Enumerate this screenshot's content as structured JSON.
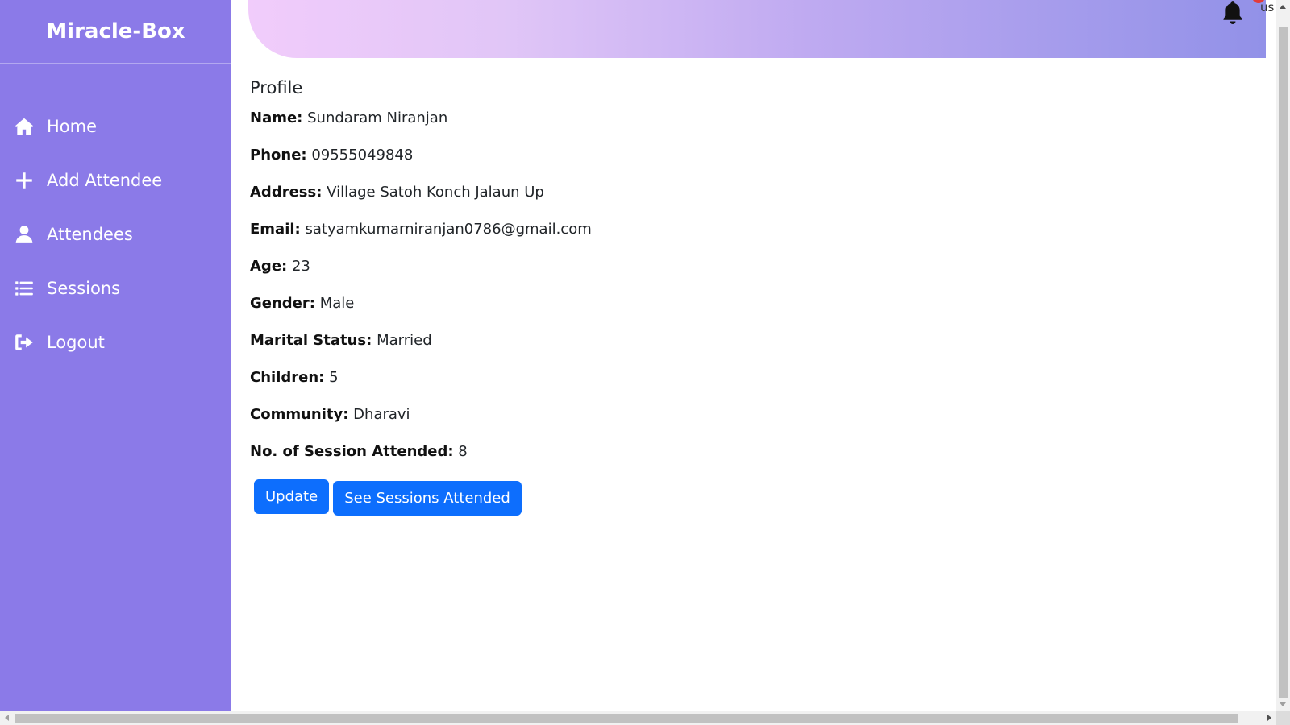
{
  "brand": "Miracle-Box",
  "sidebar": {
    "items": [
      {
        "label": "Home",
        "icon": "home-icon"
      },
      {
        "label": "Add Attendee",
        "icon": "plus-icon"
      },
      {
        "label": "Attendees",
        "icon": "user-icon"
      },
      {
        "label": "Sessions",
        "icon": "list-icon"
      },
      {
        "label": "Logout",
        "icon": "logout-icon"
      }
    ]
  },
  "header": {
    "user_text": "us"
  },
  "profile": {
    "title": "Profile",
    "fields": [
      {
        "label": "Name:",
        "value": "Sundaram Niranjan"
      },
      {
        "label": "Phone:",
        "value": "09555049848"
      },
      {
        "label": "Address:",
        "value": "Village Satoh Konch Jalaun Up"
      },
      {
        "label": "Email:",
        "value": "satyamkumarniranjan0786@gmail.com"
      },
      {
        "label": "Age:",
        "value": "23"
      },
      {
        "label": "Gender:",
        "value": "Male"
      },
      {
        "label": "Marital Status:",
        "value": "Married"
      },
      {
        "label": "Children:",
        "value": "5"
      },
      {
        "label": "Community:",
        "value": "Dharavi"
      },
      {
        "label": "No. of Session Attended:",
        "value": "8"
      }
    ],
    "update_label": "Update",
    "sessions_label": "See Sessions Attended"
  },
  "colors": {
    "sidebar": "#8b7ae8",
    "button": "#0d6efd",
    "banner_start": "#f1ccfb",
    "banner_end": "#9291e8"
  }
}
